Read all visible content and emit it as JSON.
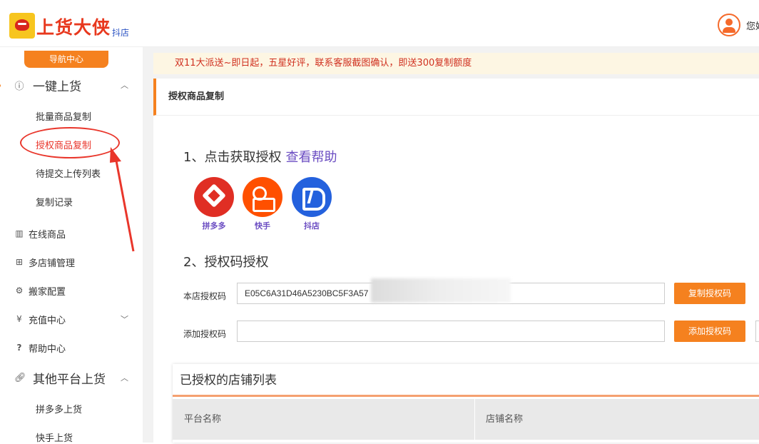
{
  "header": {
    "logo_text": "上货大侠",
    "logo_sub": "抖店",
    "user_name": "您好"
  },
  "sidebar": {
    "nav_center_label": "导航中心",
    "group_one_click": "一键上货",
    "sub_items": [
      "批量商品复制",
      "授权商品复制",
      "待提交上传列表",
      "复制记录"
    ],
    "main_items": [
      {
        "icon": "list-icon",
        "label": "在线商品"
      },
      {
        "icon": "shops-icon",
        "label": "多店铺管理"
      },
      {
        "icon": "settings-icon",
        "label": "搬家配置"
      },
      {
        "icon": "yen-icon",
        "label": "充值中心"
      },
      {
        "icon": "question-icon",
        "label": "帮助中心"
      }
    ],
    "group_other": "其他平台上货",
    "other_sub_items": [
      "拼多多上货",
      "快手上货"
    ],
    "annotation_color": "#e9362b"
  },
  "notice": "双11大派送~即日起，五星好评，联系客服截图确认，即送300复制额度",
  "panel": {
    "title": "授权商品复制",
    "step1_title": "1、点击获取授权",
    "help_link": "查看帮助",
    "platforms": [
      {
        "name": "拼多多",
        "color": "#e02e24"
      },
      {
        "name": "快手",
        "color": "#ff5000"
      },
      {
        "name": "抖店",
        "color": "#2461dd"
      }
    ],
    "step2_title": "2、授权码授权",
    "store_code_label": "本店授权码",
    "store_code_value": "E05C6A31D46A5230BC5F3A57",
    "copy_button": "复制授权码",
    "add_code_label": "添加授权码",
    "add_code_value": "",
    "add_button": "添加授权码"
  },
  "shop_list": {
    "title": "已授权的店铺列表",
    "columns": [
      "平台名称",
      "店铺名称"
    ]
  },
  "accent_color": "#f5811f"
}
